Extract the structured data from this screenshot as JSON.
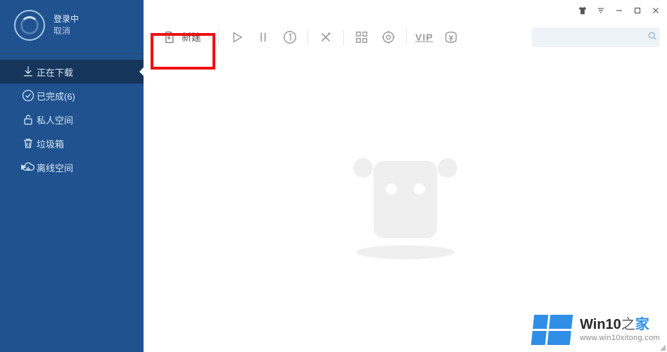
{
  "user": {
    "status": "登录中",
    "cancel": "取消"
  },
  "sidebar": {
    "items": [
      {
        "label": "正在下载",
        "icon": "download-icon",
        "active": true
      },
      {
        "label": "已完成(6)",
        "icon": "check-icon",
        "active": false
      },
      {
        "label": "私人空间",
        "icon": "lock-icon",
        "active": false
      },
      {
        "label": "垃圾箱",
        "icon": "trash-icon",
        "active": false
      },
      {
        "label": "离线空间",
        "icon": "cloud-icon",
        "active": false,
        "expandable": true
      }
    ]
  },
  "toolbar": {
    "new_label": "新建",
    "vip_label": "VIP"
  },
  "search": {
    "placeholder": ""
  },
  "watermark": {
    "title_prefix": "Win10",
    "title_mid": "之",
    "title_suffix": "家",
    "url": "www.win10xitong.com"
  },
  "colors": {
    "sidebar_bg": "#1f528f",
    "sidebar_active_bg": "#16355b",
    "accent": "#2f8fe6",
    "highlight_border": "#e11"
  }
}
